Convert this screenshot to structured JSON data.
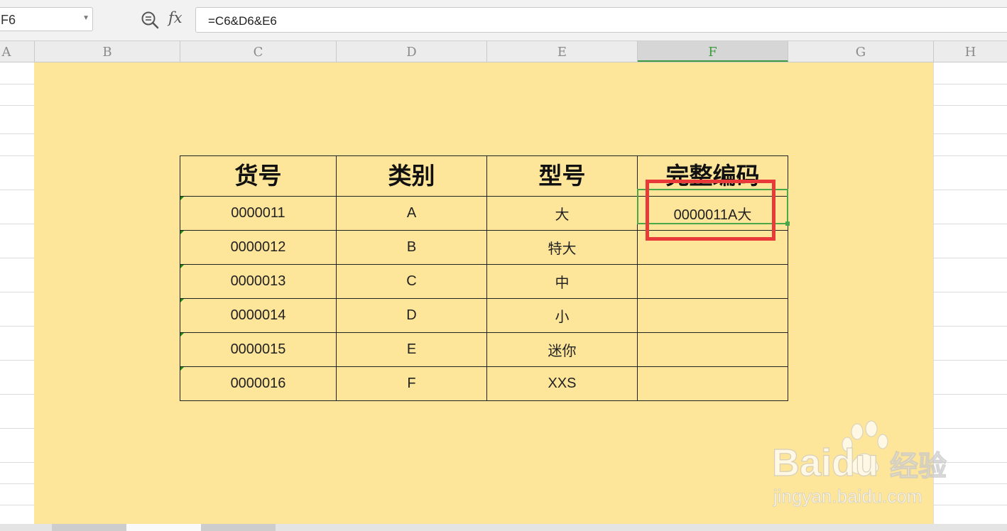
{
  "formula_bar": {
    "name_box": "F6",
    "fx_label": "fx",
    "formula": "=C6&D6&E6"
  },
  "columns": [
    "A",
    "B",
    "C",
    "D",
    "E",
    "F",
    "G",
    "H"
  ],
  "selected_column": "F",
  "table": {
    "headers": [
      "货号",
      "类别",
      "型号",
      "完整编码"
    ],
    "rows": [
      [
        "0000011",
        "A",
        "大",
        "0000011A大"
      ],
      [
        "0000012",
        "B",
        "特大",
        ""
      ],
      [
        "0000013",
        "C",
        "中",
        ""
      ],
      [
        "0000014",
        "D",
        "小",
        ""
      ],
      [
        "0000015",
        "E",
        "迷你",
        ""
      ],
      [
        "0000016",
        "F",
        "XXS",
        ""
      ]
    ]
  },
  "watermark": {
    "brand": "Baidu",
    "suffix": "经验",
    "url": "jingyan.baidu.com"
  },
  "colors": {
    "sheet_fill": "#fde59a",
    "selection_green": "#4aa84a",
    "highlight_red": "#e93a3a"
  }
}
